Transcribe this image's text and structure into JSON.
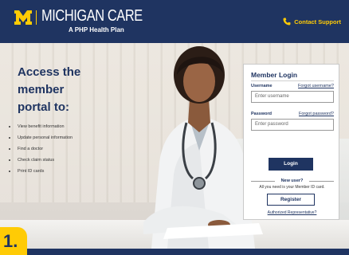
{
  "header": {
    "logo_text": "MICHIGAN CARE",
    "logo_subtitle": "A PHP Health Plan",
    "contact_label": "Contact Support"
  },
  "intro": {
    "heading_line1": "Access the member",
    "heading_line2": "portal to:",
    "items": [
      "View benefit information",
      "Update personal information",
      "Find a doctor",
      "Check claim status",
      "Print ID cards"
    ]
  },
  "login": {
    "title": "Member Login",
    "username_label": "Username",
    "forgot_username": "Forgot username?",
    "username_placeholder": "Enter username",
    "password_label": "Password",
    "forgot_password": "Forgot password?",
    "password_placeholder": "Enter password",
    "login_button": "Login",
    "new_user_heading": "New user?",
    "new_user_text": "All you need is your Member ID card.",
    "register_button": "Register",
    "authorized_rep_link": "Authorized Representative?"
  },
  "step_badge": "1.",
  "colors": {
    "navy": "#1f3461",
    "maize": "#ffcb05"
  },
  "icons": {
    "logo": "block-m-logo",
    "contact": "phone-icon"
  }
}
